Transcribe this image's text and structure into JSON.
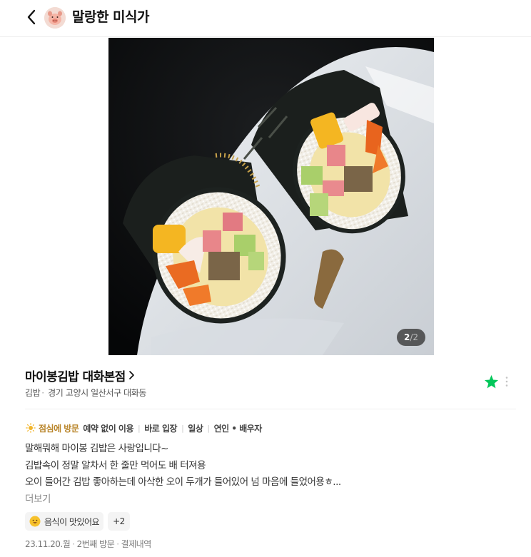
{
  "header": {
    "user_name": "말랑한 미식가",
    "back_icon": "chevron-left-icon",
    "avatar_icon": "pig-avatar"
  },
  "photo": {
    "current": "2",
    "separator": "/",
    "total": "2"
  },
  "place": {
    "name": "마이봉김밥 대화본점",
    "category": "김밥",
    "address": "경기 고양시 일산서구 대화동",
    "saved": true,
    "star_color": "#03c75a"
  },
  "tags": {
    "visit_time": "점심에 방문",
    "items": [
      "예약 없이 이용",
      "바로 입장",
      "일상",
      "연인 • 배우자"
    ]
  },
  "review": {
    "lines": [
      "말해뭐해 마이봉 김밥은 사랑입니다~",
      "김밥속이 정말 알차서 한 줄만 먹어도 배 터져용",
      "오이 들어간 김밥 좋아하는데 아삭한 오이 두개가 들어있어 넘 마음에 들었어용ㅎ..."
    ],
    "more_label": "더보기"
  },
  "chips": {
    "first_label": "음식이 맛있어요",
    "extra_count": "+2"
  },
  "footer": {
    "date": "23.11.20.월",
    "visit_count": "2번째 방문",
    "receipt": "결제내역"
  }
}
